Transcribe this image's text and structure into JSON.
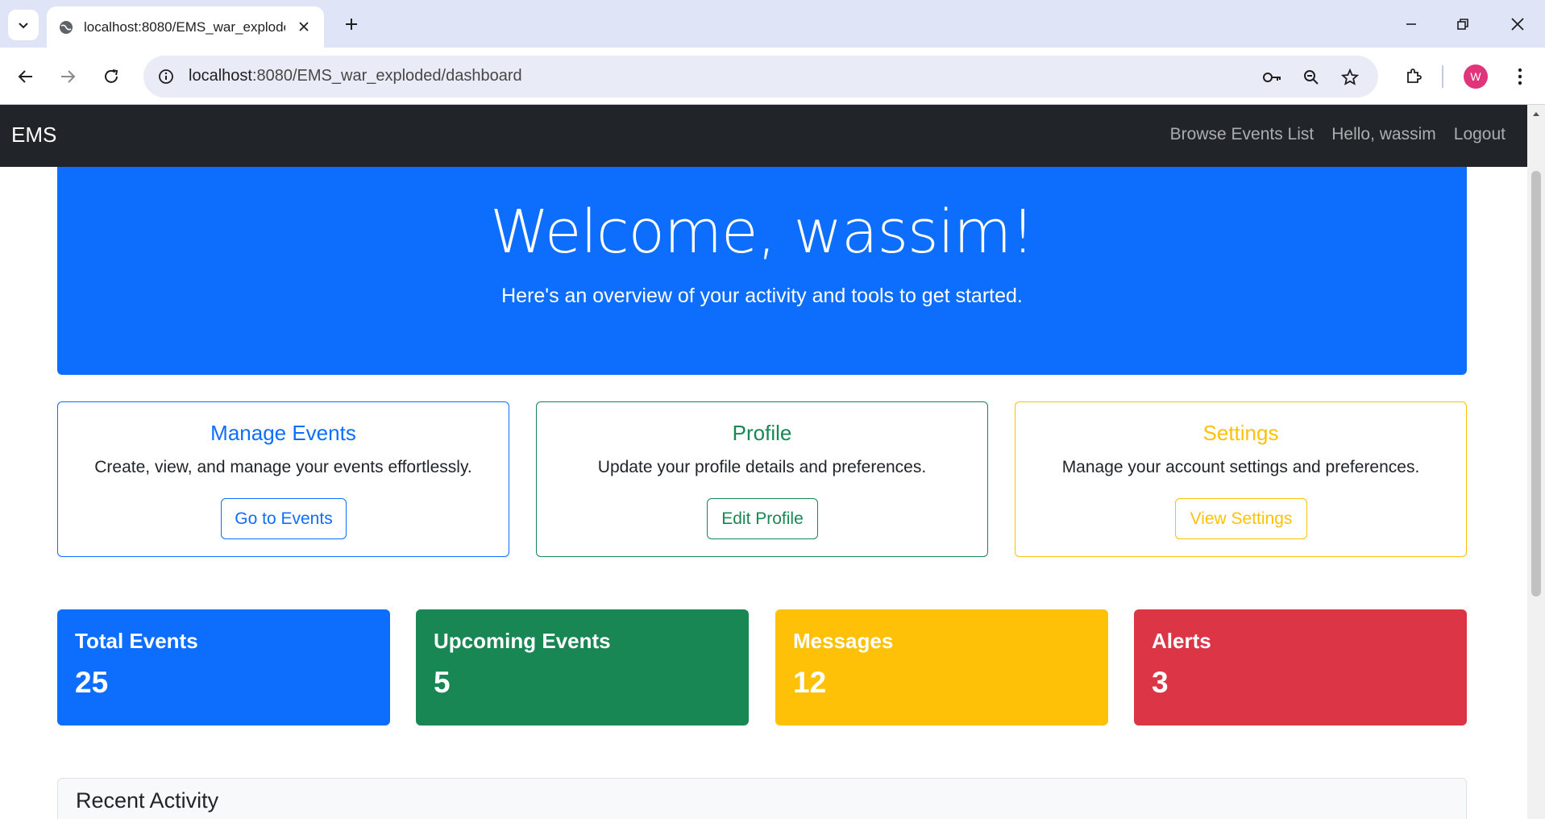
{
  "browser": {
    "tab_title": "localhost:8080/EMS_war_exploded",
    "url_host": "localhost",
    "url_rest": ":8080/EMS_war_exploded/dashboard",
    "avatar_letter": "W"
  },
  "navbar": {
    "brand": "EMS",
    "links": [
      "Browse Events List",
      "Hello, wassim",
      "Logout"
    ]
  },
  "hero": {
    "title": "Welcome, wassim!",
    "subtitle": "Here's an overview of your activity and tools to get started."
  },
  "cards": [
    {
      "title": "Manage Events",
      "text": "Create, view, and manage your events effortlessly.",
      "button": "Go to Events",
      "color": "#0d6efd"
    },
    {
      "title": "Profile",
      "text": "Update your profile details and preferences.",
      "button": "Edit Profile",
      "color": "#198754"
    },
    {
      "title": "Settings",
      "text": "Manage your account settings and preferences.",
      "button": "View Settings",
      "color": "#ffc107"
    }
  ],
  "stats": [
    {
      "label": "Total Events",
      "value": "25",
      "color": "#0d6efd"
    },
    {
      "label": "Upcoming Events",
      "value": "5",
      "color": "#198754"
    },
    {
      "label": "Messages",
      "value": "12",
      "color": "#ffc107"
    },
    {
      "label": "Alerts",
      "value": "3",
      "color": "#dc3545"
    }
  ],
  "activity": {
    "title": "Recent Activity"
  }
}
